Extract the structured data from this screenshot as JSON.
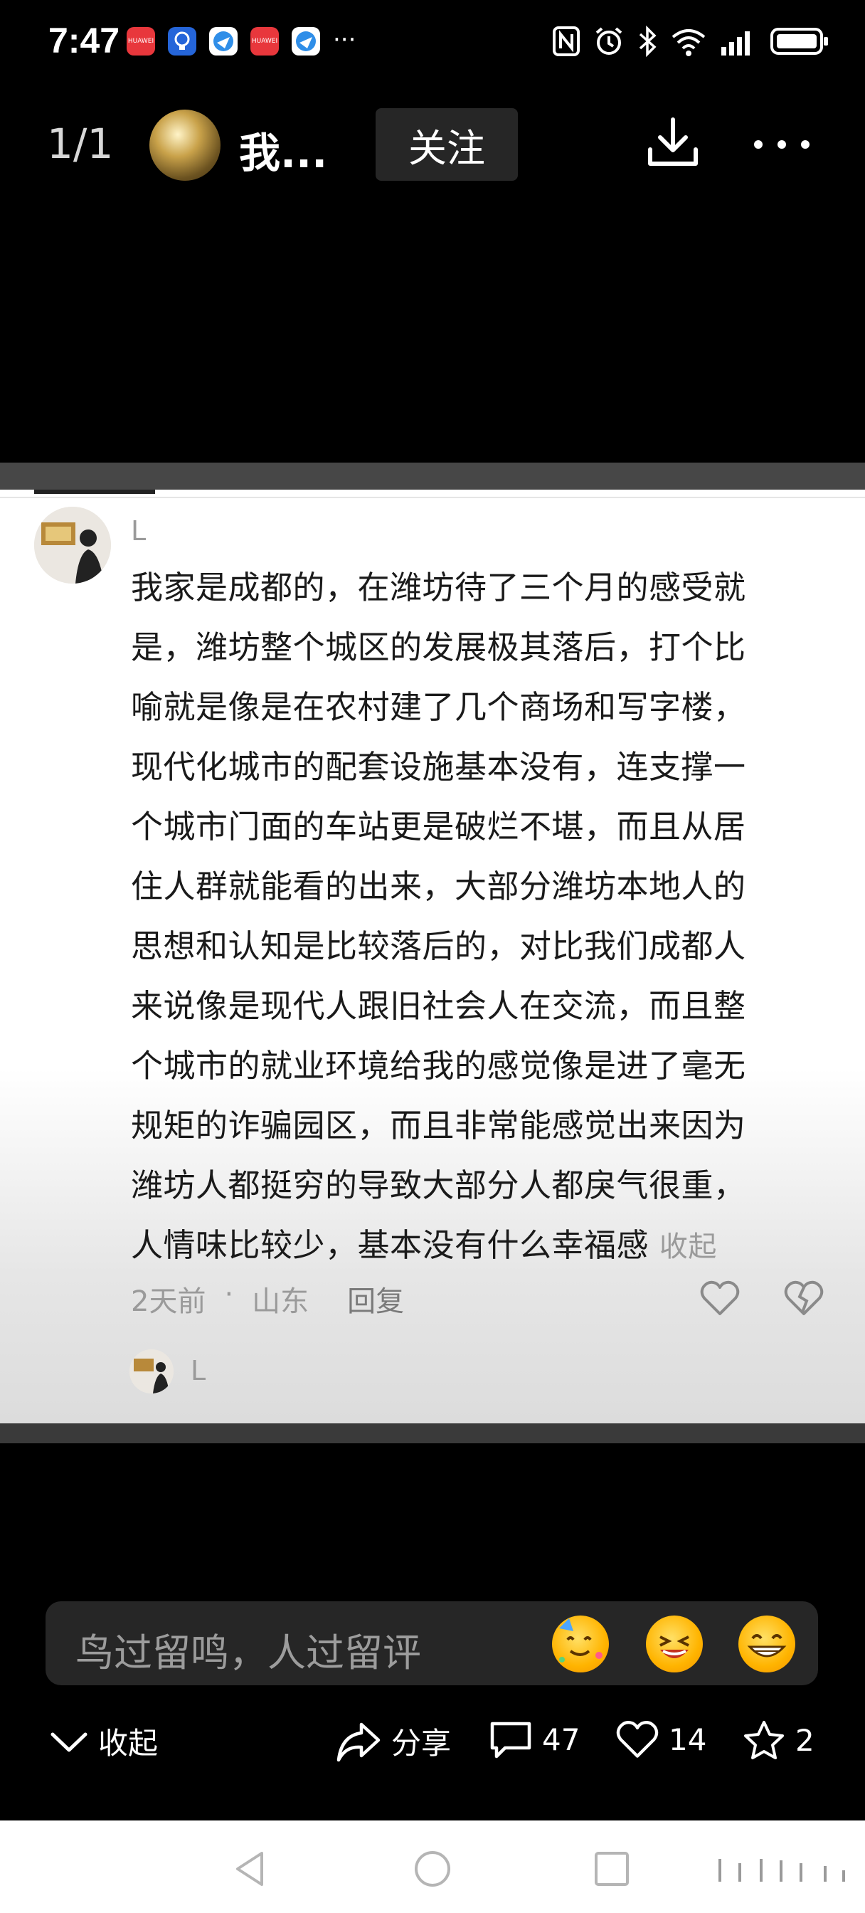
{
  "status_bar": {
    "time": "7:47",
    "more": "···",
    "app_icon_label": "HUAWEI"
  },
  "header": {
    "page_counter": "1/1",
    "author_name": "我...",
    "follow_label": "关注"
  },
  "comment": {
    "author": "L",
    "lines": [
      "我家是成都的，在潍坊待了三个月的感受就",
      "是，潍坊整个城区的发展极其落后，打个比",
      "喻就是像是在农村建了几个商场和写字楼，",
      "现代化城市的配套设施基本没有，连支撑一",
      "个城市门面的车站更是破烂不堪，而且从居",
      "住人群就能看的出来，大部分潍坊本地人的",
      "思想和认知是比较落后的，对比我们成都人",
      "来说像是现代人跟旧社会人在交流，而且整",
      "个城市的就业环境给我的感觉像是进了毫无",
      "规矩的诈骗园区，而且非常能感觉出来因为",
      "潍坊人都挺穷的导致大部分人都戾气很重，",
      "人情味比较少，基本没有什么幸福感"
    ],
    "collapse_label": "收起",
    "time_ago": "2天前",
    "separator": "·",
    "location": "山东",
    "reply_label": "回复",
    "reply_author": "L"
  },
  "comment_input": {
    "placeholder": "鸟过留鸣，人过留评"
  },
  "actions": {
    "collapse_label": "收起",
    "share_label": "分享",
    "comments_count": "47",
    "likes_count": "14",
    "favorites_count": "2"
  }
}
